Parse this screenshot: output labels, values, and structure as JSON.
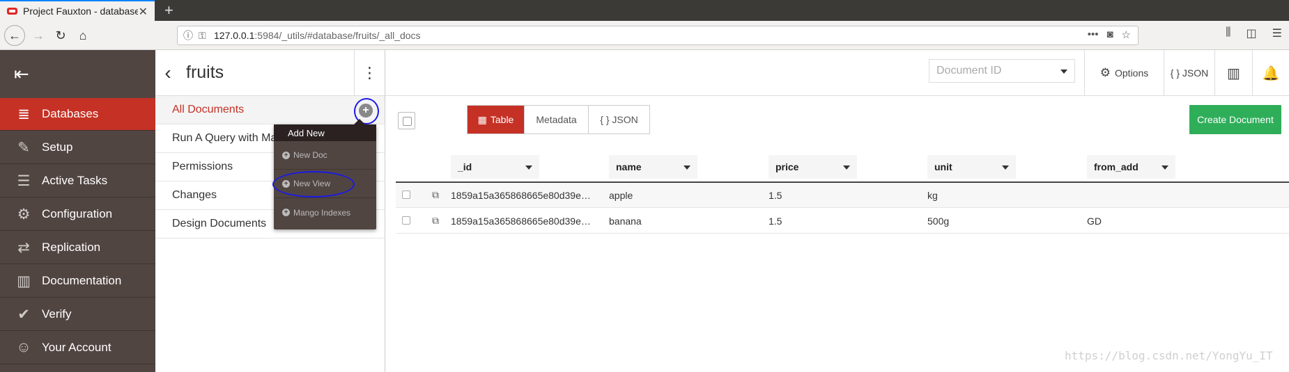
{
  "browser": {
    "tab_title": "Project Fauxton - database",
    "url_host": "127.0.0.1",
    "url_rest": ":5984/_utils/#database/fruits/_all_docs"
  },
  "sidebar": {
    "items": [
      {
        "label": "Databases",
        "icon": "database-icon",
        "active": true
      },
      {
        "label": "Setup",
        "icon": "wrench-icon"
      },
      {
        "label": "Active Tasks",
        "icon": "tasks-icon"
      },
      {
        "label": "Configuration",
        "icon": "gear-icon"
      },
      {
        "label": "Replication",
        "icon": "replication-icon"
      },
      {
        "label": "Documentation",
        "icon": "book-icon"
      },
      {
        "label": "Verify",
        "icon": "check-icon"
      },
      {
        "label": "Your Account",
        "icon": "user-icon"
      }
    ]
  },
  "subnav": {
    "db_name": "fruits",
    "items": [
      "All Documents",
      "Run A Query with Ma",
      "Permissions",
      "Changes",
      "Design Documents"
    ]
  },
  "add_new_menu": {
    "header": "Add New",
    "items": [
      "New Doc",
      "New View",
      "Mango Indexes"
    ]
  },
  "header": {
    "docid_placeholder": "Document ID",
    "options_label": "Options",
    "json_label": "{ } JSON"
  },
  "view_tabs": [
    "Table",
    "Metadata",
    "{ } JSON"
  ],
  "create_document_label": "Create Document",
  "table": {
    "columns": [
      "_id",
      "name",
      "price",
      "unit",
      "from_add"
    ],
    "rows": [
      [
        "1859a15a365868665e80d39e…",
        "apple",
        "1.5",
        "kg",
        ""
      ],
      [
        "1859a15a365868665e80d39e…",
        "banana",
        "1.5",
        "500g",
        "GD"
      ]
    ]
  },
  "watermark": "https://blog.csdn.net/YongYu_IT",
  "colors": {
    "sidebar": "#514542",
    "active": "#c53125",
    "create": "#2fae5a",
    "annotation": "#1a1ae8"
  }
}
